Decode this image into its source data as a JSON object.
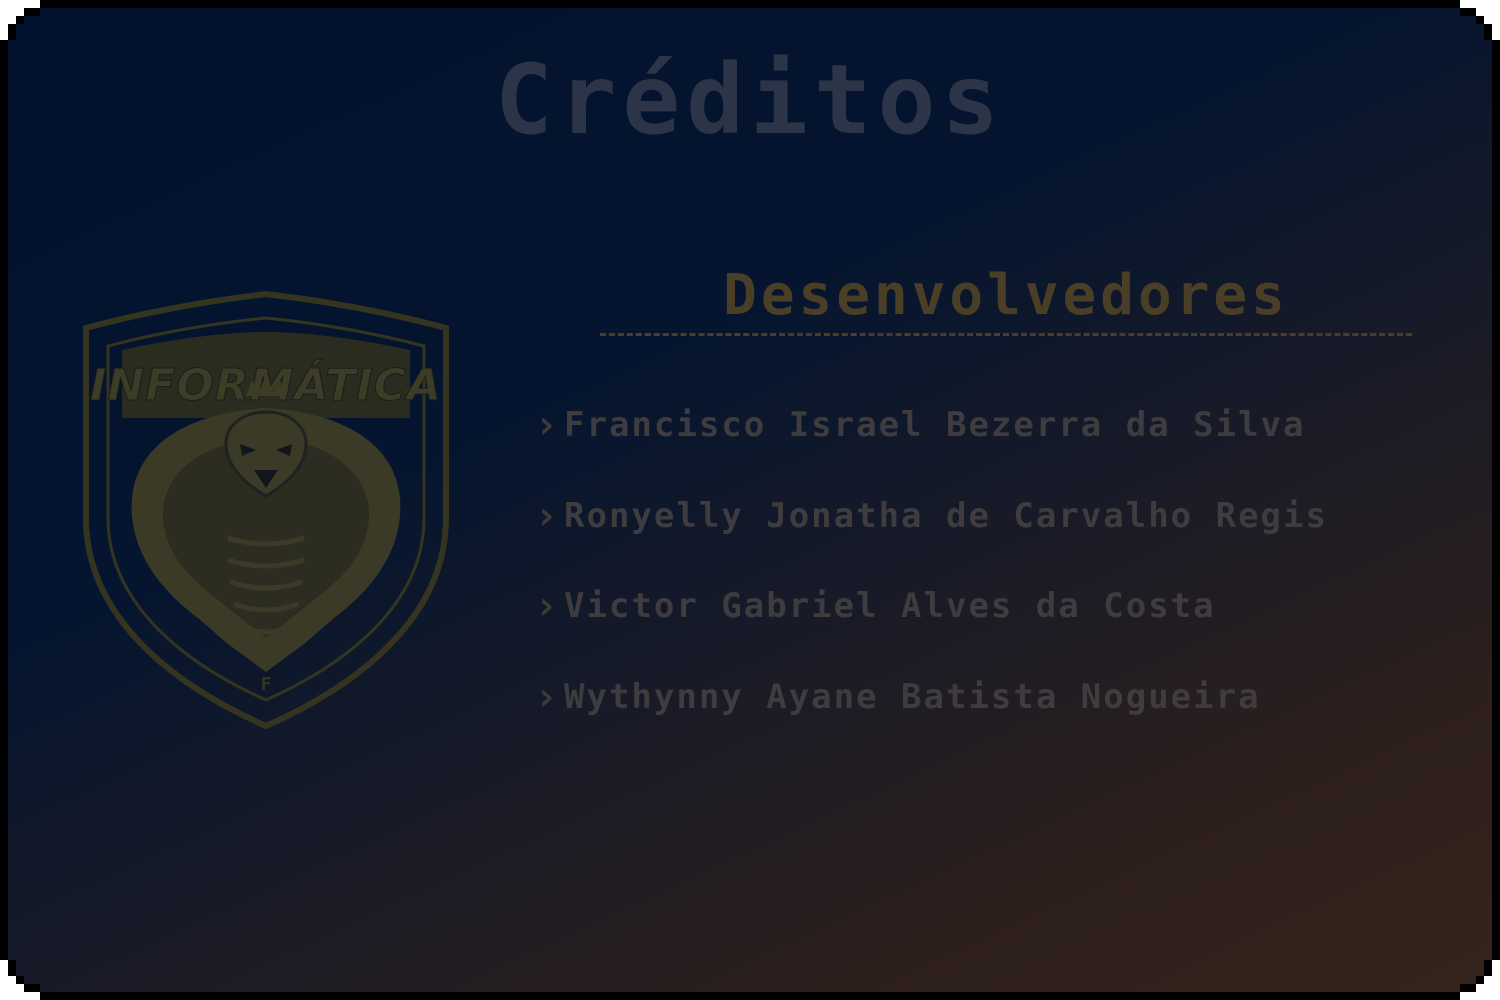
{
  "screen": {
    "title": "Créditos"
  },
  "logo": {
    "text": "INFORMÁTICA",
    "icon": "cobra-crest-icon",
    "color": "#3a3a26"
  },
  "developers": {
    "heading": "Desenvolvedores",
    "bullet_icon": "chevron-right-icon",
    "names": [
      "Francisco Israel Bezerra da Silva",
      "Ronyelly Jonatha de Carvalho Regis",
      "Victor Gabriel Alves da Costa",
      "Wythynny Ayane Batista Nogueira"
    ]
  },
  "colors": {
    "title": "#2c3547",
    "heading": "#4a3f26",
    "names": "#3f3c3f",
    "background_left": "#02112e",
    "background_right": "#35241b"
  }
}
